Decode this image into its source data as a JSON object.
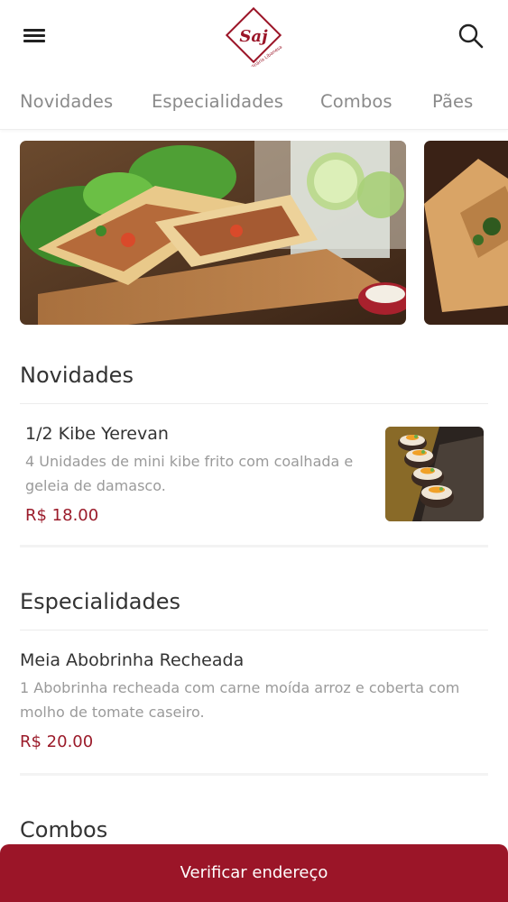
{
  "header": {
    "menu_icon": "hamburger-menu-icon",
    "logo_text": "Saj",
    "logo_subtext": "Culinária Libanesa",
    "search_icon": "search-icon",
    "brand_color": "#9b1528"
  },
  "tabs": [
    {
      "label": "Novidades"
    },
    {
      "label": "Especialidades"
    },
    {
      "label": "Combos"
    },
    {
      "label": "Pães"
    }
  ],
  "sections": [
    {
      "title": "Novidades",
      "item": {
        "name": "1/2 Kibe Yerevan",
        "description": "4 Unidades de mini kibe frito com coalhada e geleia de damasco.",
        "price": "R$ 18.00"
      }
    },
    {
      "title": "Especialidades",
      "item": {
        "name": "Meia Abobrinha Recheada",
        "description": "1 Abobrinha recheada com carne moída arroz e coberta com molho de tomate caseiro.",
        "price": "R$ 20.00"
      }
    },
    {
      "title": "Combos"
    }
  ],
  "cta": {
    "label": "Verificar endereço"
  }
}
